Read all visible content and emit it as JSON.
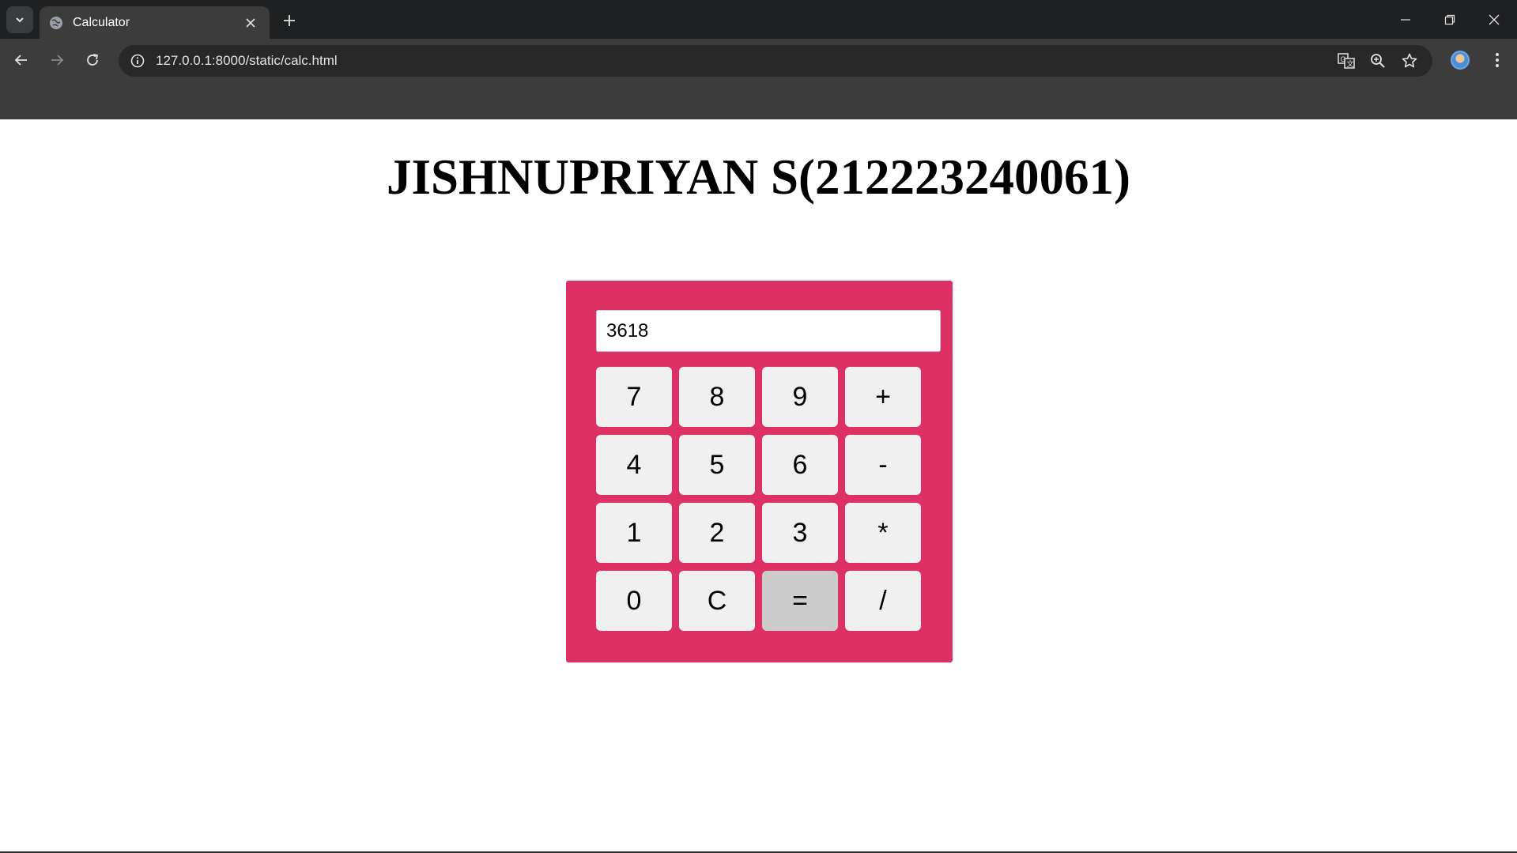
{
  "browser": {
    "tab_title": "Calculator",
    "url": "127.0.0.1:8000/static/calc.html",
    "icons": [
      "tab-search-icon",
      "globe-icon",
      "close-icon",
      "plus-icon",
      "minimize-icon",
      "restore-icon",
      "close-window-icon",
      "back-icon",
      "forward-icon",
      "reload-icon",
      "info-icon",
      "translate-icon",
      "zoom-icon",
      "star-icon",
      "profile-avatar",
      "more-icon"
    ]
  },
  "page": {
    "title": "JISHNUPRIYAN S(212223240061)"
  },
  "calculator": {
    "display_value": "3618",
    "keys": [
      "7",
      "8",
      "9",
      "+",
      "4",
      "5",
      "6",
      "-",
      "1",
      "2",
      "3",
      "*",
      "0",
      "C",
      "=",
      "/"
    ],
    "pressed_key": "="
  },
  "colors": {
    "calculator_bg": "#dd3166",
    "key_bg": "#f0f0f0",
    "key_pressed_bg": "#cccccc",
    "chrome_dark": "#1f2022",
    "chrome_toolbar": "#3c3c3c"
  }
}
